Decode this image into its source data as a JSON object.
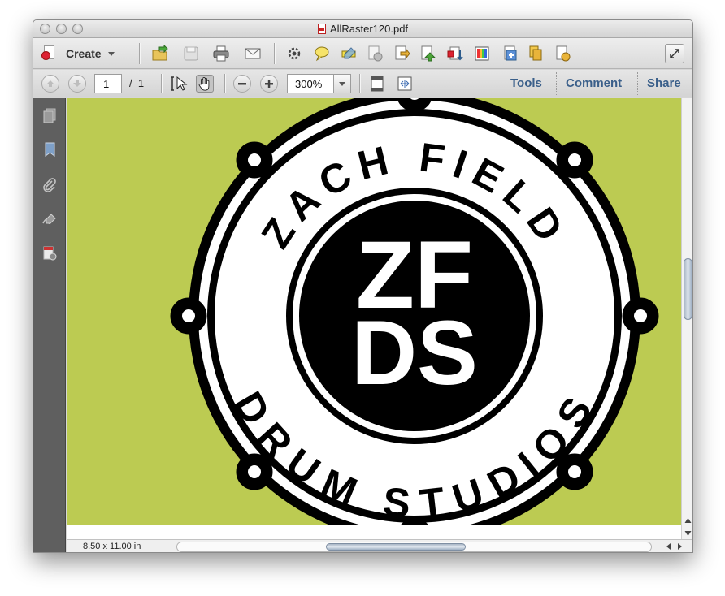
{
  "window": {
    "title": "AllRaster120.pdf"
  },
  "toolbar": {
    "create_label": "Create",
    "icons": [
      "open-folder-icon",
      "save-icon",
      "print-icon",
      "email-icon",
      "settings-gear-icon",
      "comment-bubble-icon",
      "highlight-icon",
      "delete-page-icon",
      "export-icon",
      "share-icon",
      "sign-icon",
      "arrange-icon",
      "color-icon",
      "compare-icon",
      "combine-icon",
      "send-icon"
    ],
    "expand_icon": "full-screen-icon"
  },
  "nav": {
    "current_page": "1",
    "page_separator": "/",
    "total_pages": "1",
    "zoom": "300%"
  },
  "panels": {
    "tools": "Tools",
    "comment": "Comment",
    "share": "Share"
  },
  "sidebar": {
    "icons": [
      "pages-icon",
      "bookmark-icon",
      "attachment-icon",
      "signature-icon",
      "security-icon"
    ]
  },
  "document": {
    "page_color": "#bccb52",
    "logo": {
      "top_text": "ZACH FIELD",
      "bottom_text": "DRUM STUDIOS",
      "monogram_line1": "ZF",
      "monogram_line2": "DS"
    }
  },
  "status": {
    "page_size": "8.50 x 11.00 in"
  }
}
